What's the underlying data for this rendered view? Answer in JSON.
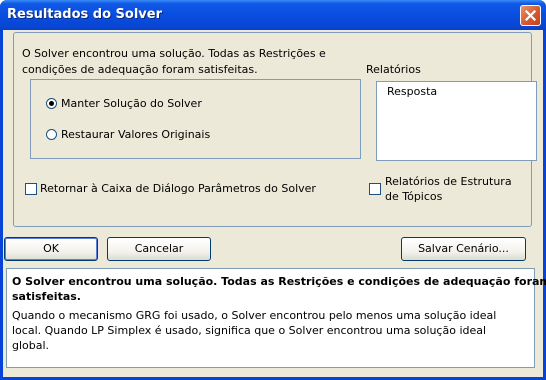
{
  "window": {
    "title": "Resultados do Solver",
    "close_icon": "close-icon"
  },
  "main": {
    "message_line1": "O Solver encontrou uma solução.  Todas as Restrições e",
    "message_line2": "condições de adequação foram satisfeitas.",
    "radio_keep_label": "Manter Solução do Solver",
    "radio_keep_selected": true,
    "radio_restore_label": "Restaurar Valores Originais",
    "radio_restore_selected": false,
    "return_checkbox_label": "Retornar à Caixa de Diálogo Parâmetros do Solver",
    "return_checkbox_checked": false
  },
  "reports": {
    "label": "Relatórios",
    "items": [
      "Resposta"
    ],
    "outline_checkbox_label_line1": "Relatórios de Estrutura",
    "outline_checkbox_label_line2": "de Tópicos",
    "outline_checkbox_checked": false
  },
  "buttons": {
    "ok_label": "OK",
    "cancel_label": "Cancelar",
    "save_scenario_label": "Salvar Cenário..."
  },
  "info": {
    "bold_line1": "O Solver encontrou uma solução.  Todas as Restrições e condições de adequação foram",
    "bold_line2": "satisfeitas.",
    "line1": "Quando o mecanismo GRG foi usado, o Solver encontrou pelo menos uma solução ideal",
    "line2": "local. Quando LP Simplex é usado, significa que o Solver encontrou uma solução ideal",
    "line3": "global."
  }
}
